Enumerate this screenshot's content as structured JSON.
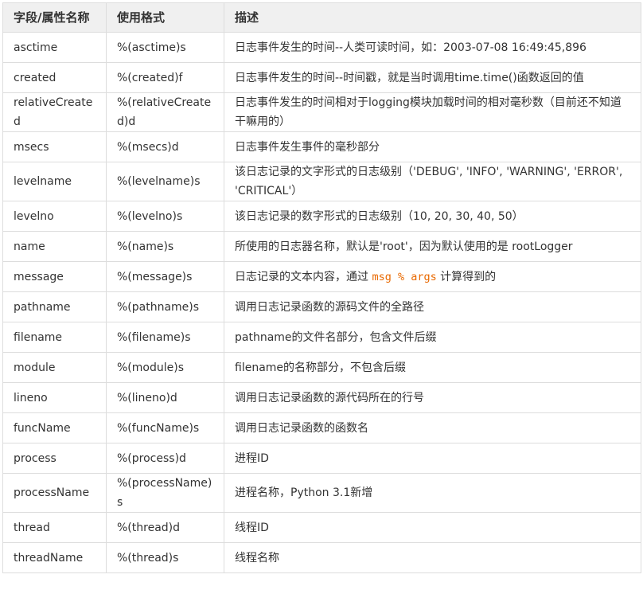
{
  "table": {
    "headers": [
      "字段/属性名称",
      "使用格式",
      "描述"
    ],
    "rows": [
      {
        "field": "asctime",
        "format": "%(asctime)s",
        "desc": "日志事件发生的时间--人类可读时间，如：2003-07-08 16:49:45,896"
      },
      {
        "field": "created",
        "format": "%(created)f",
        "desc": "日志事件发生的时间--时间戳，就是当时调用time.time()函数返回的值"
      },
      {
        "field": "relativeCreated",
        "format": "%(relativeCreated)d",
        "desc": "日志事件发生的时间相对于logging模块加载时间的相对毫秒数（目前还不知道干嘛用的）"
      },
      {
        "field": "msecs",
        "format": "%(msecs)d",
        "desc": "日志事件发生事件的毫秒部分"
      },
      {
        "field": "levelname",
        "format": "%(levelname)s",
        "desc": "该日志记录的文字形式的日志级别（'DEBUG', 'INFO', 'WARNING', 'ERROR', 'CRITICAL'）"
      },
      {
        "field": "levelno",
        "format": "%(levelno)s",
        "desc": "该日志记录的数字形式的日志级别（10, 20, 30, 40, 50）"
      },
      {
        "field": "name",
        "format": "%(name)s",
        "desc": "所使用的日志器名称，默认是'root'，因为默认使用的是 rootLogger"
      },
      {
        "field": "message",
        "format": "%(message)s",
        "desc_before": "日志记录的文本内容，通过 ",
        "desc_code": "msg % args",
        "desc_after": " 计算得到的"
      },
      {
        "field": "pathname",
        "format": "%(pathname)s",
        "desc": "调用日志记录函数的源码文件的全路径"
      },
      {
        "field": "filename",
        "format": "%(filename)s",
        "desc": "pathname的文件名部分，包含文件后缀"
      },
      {
        "field": "module",
        "format": "%(module)s",
        "desc": "filename的名称部分，不包含后缀"
      },
      {
        "field": "lineno",
        "format": "%(lineno)d",
        "desc": "调用日志记录函数的源代码所在的行号"
      },
      {
        "field": "funcName",
        "format": "%(funcName)s",
        "desc": "调用日志记录函数的函数名"
      },
      {
        "field": "process",
        "format": "%(process)d",
        "desc": "进程ID"
      },
      {
        "field": "processName",
        "format": "%(processName)s",
        "desc": "进程名称，Python 3.1新增"
      },
      {
        "field": "thread",
        "format": "%(thread)d",
        "desc": "线程ID"
      },
      {
        "field": "threadName",
        "format": "%(thread)s",
        "desc": "线程名称"
      }
    ]
  },
  "colors": {
    "header_bg": "#f0f0f0",
    "border": "#dddddd",
    "text": "#333333",
    "code": "#e96900"
  }
}
